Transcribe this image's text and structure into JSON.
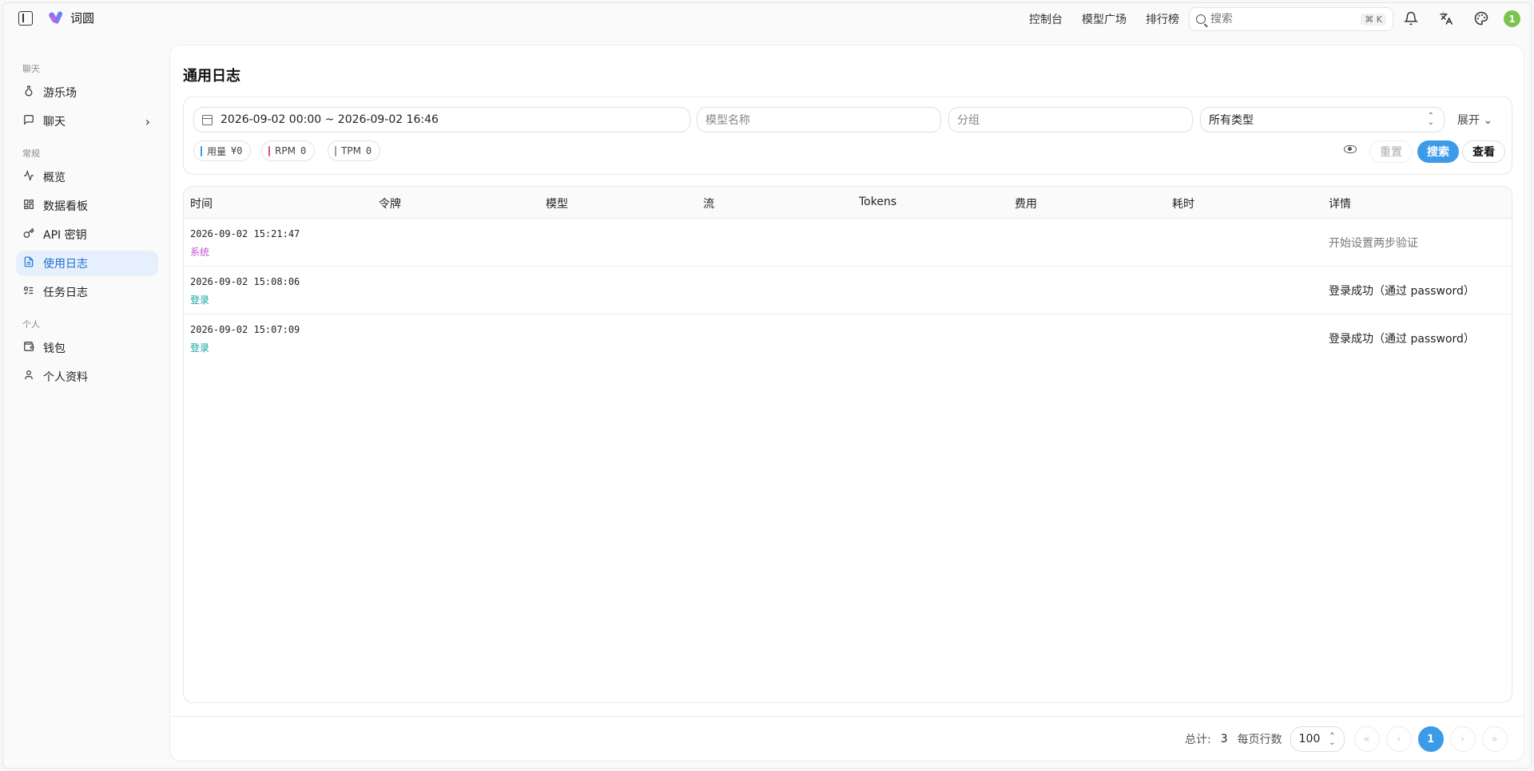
{
  "app": {
    "name": "词圆"
  },
  "topnav": {
    "items": [
      "控制台",
      "模型广场",
      "排行榜"
    ]
  },
  "search": {
    "placeholder": "搜索",
    "shortcut": "⌘ K"
  },
  "user": {
    "avatar_initial": "1"
  },
  "sidebar": {
    "sections": [
      {
        "title": "聊天",
        "items": [
          {
            "label": "游乐场",
            "icon": "flask-icon"
          },
          {
            "label": "聊天",
            "icon": "chat-icon",
            "has_submenu": true
          }
        ]
      },
      {
        "title": "常规",
        "items": [
          {
            "label": "概览",
            "icon": "activity-icon"
          },
          {
            "label": "数据看板",
            "icon": "dashboard-icon"
          },
          {
            "label": "API 密钥",
            "icon": "key-icon"
          },
          {
            "label": "使用日志",
            "icon": "document-icon",
            "active": true
          },
          {
            "label": "任务日志",
            "icon": "tasklist-icon"
          }
        ]
      },
      {
        "title": "个人",
        "items": [
          {
            "label": "钱包",
            "icon": "wallet-icon"
          },
          {
            "label": "个人资料",
            "icon": "user-icon"
          }
        ]
      }
    ]
  },
  "page": {
    "title": "通用日志"
  },
  "filters": {
    "date_range": "2026-09-02 00:00 ~ 2026-09-02 16:46",
    "model_placeholder": "模型名称",
    "group_placeholder": "分组",
    "type_select": "所有类型",
    "expand_label": "展开"
  },
  "stats": {
    "usage_label": "用量",
    "usage_value": "¥0",
    "usage_color": "#3b9be8",
    "rpm_label": "RPM",
    "rpm_value": "0",
    "rpm_color": "#e0507a",
    "tpm_label": "TPM",
    "tpm_value": "0",
    "tpm_color": "#a0a0a0"
  },
  "actions": {
    "reset": "重置",
    "search": "搜索",
    "view": "查看"
  },
  "table": {
    "headers": [
      "时间",
      "令牌",
      "模型",
      "流",
      "Tokens",
      "费用",
      "耗时",
      "详情"
    ],
    "rows": [
      {
        "time": "2026-09-02 15:21:47",
        "type": "系统",
        "type_color": "#c355d6",
        "detail": "开始设置两步验证"
      },
      {
        "time": "2026-09-02 15:08:06",
        "type": "登录",
        "type_color": "#17a6a0",
        "detail": "登录成功（通过 password）"
      },
      {
        "time": "2026-09-02 15:07:09",
        "type": "登录",
        "type_color": "#17a6a0",
        "detail": "登录成功（通过 password）"
      }
    ]
  },
  "pagination": {
    "total_label": "总计:",
    "total": "3",
    "rows_per_page_label": "每页行数",
    "rows_per_page": "100",
    "current_page": "1"
  }
}
